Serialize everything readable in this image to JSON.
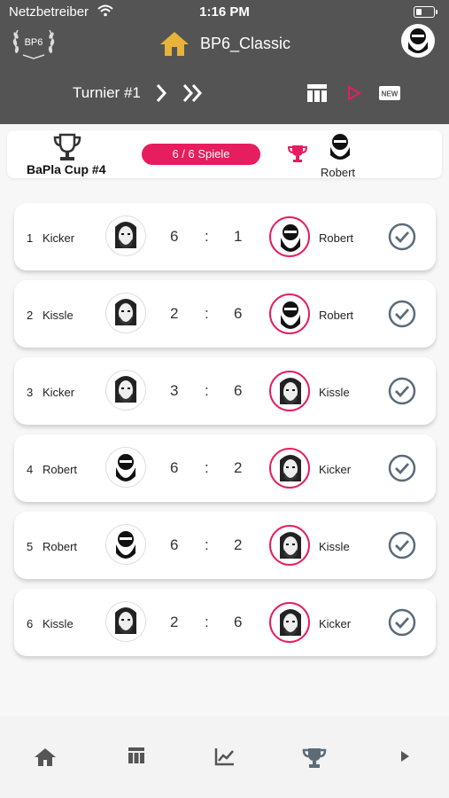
{
  "status": {
    "carrier": "Netzbetreiber",
    "time": "1:16 PM"
  },
  "header": {
    "logo_text": "BP6",
    "title": "BP6_Classic",
    "tournament": "Turnier #1"
  },
  "cup": {
    "name": "BaPla Cup #4",
    "games": "6 / 6 Spiele",
    "winner": "Robert"
  },
  "matches": [
    {
      "idx": "1",
      "p1": "Kicker",
      "s1": "6",
      "colon": ":",
      "s2": "1",
      "p2": "Robert"
    },
    {
      "idx": "2",
      "p1": "Kissle",
      "s1": "2",
      "colon": ":",
      "s2": "6",
      "p2": "Robert"
    },
    {
      "idx": "3",
      "p1": "Kicker",
      "s1": "3",
      "colon": ":",
      "s2": "6",
      "p2": "Kissle"
    },
    {
      "idx": "4",
      "p1": "Robert",
      "s1": "6",
      "colon": ":",
      "s2": "2",
      "p2": "Kicker"
    },
    {
      "idx": "5",
      "p1": "Robert",
      "s1": "6",
      "colon": ":",
      "s2": "2",
      "p2": "Kissle"
    },
    {
      "idx": "6",
      "p1": "Kissle",
      "s1": "2",
      "colon": ":",
      "s2": "6",
      "p2": "Kicker"
    }
  ],
  "colors": {
    "header": "#545454",
    "accent": "#e61d5e",
    "home": "#e8b33a",
    "check": "#5b6b78"
  },
  "icons": [
    "wifi-icon",
    "battery-icon",
    "home-icon",
    "chevron-right-icon",
    "double-chevron-icon",
    "table-icon",
    "play-icon",
    "new-icon",
    "trophy-icon",
    "check-icon",
    "chart-icon"
  ]
}
